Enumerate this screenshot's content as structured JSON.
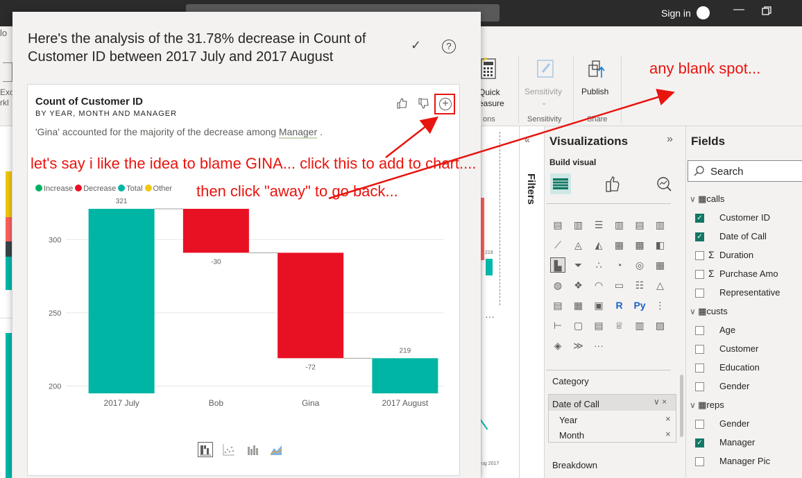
{
  "titlebar": {
    "sign_in": "Sign in",
    "min_icon": "—"
  },
  "ribbon": {
    "quick_measure": "Quick\neasure",
    "sensitivity": "Sensitivity",
    "publish": "Publish",
    "group_sensitivity": "Sensitivity",
    "group_share": "Share",
    "group_calcs": "ons",
    "left_cut_1": "Exc",
    "left_cut_2": "rkl",
    "left_cut_3": "lo"
  },
  "annotations": {
    "any_blank": "any blank spot...",
    "line1": "let's say i like the idea to blame GINA... click this to add to chart....",
    "line2": "then click \"away\" to go back...",
    "color": "#e8140e"
  },
  "modal": {
    "title": "Here's the analysis of the 31.78% decrease in Count of Customer ID between 2017 July and 2017 August",
    "card": {
      "title": "Count of Customer ID",
      "subtitle": "BY YEAR, MONTH AND MANAGER",
      "insight_pre": "'Gina' accounted for the majority of the decrease among ",
      "insight_field": "Manager",
      "insight_post": " ."
    }
  },
  "chart_data": {
    "type": "waterfall",
    "legend": [
      {
        "name": "Increase",
        "color": "#01b163"
      },
      {
        "name": "Decrease",
        "color": "#e81123"
      },
      {
        "name": "Total",
        "color": "#00b5a3"
      },
      {
        "name": "Other",
        "color": "#f2c80f"
      }
    ],
    "categories": [
      "2017 July",
      "Bob",
      "Gina",
      "2017 August"
    ],
    "bars": [
      {
        "category": "2017 July",
        "kind": "Total",
        "start": 0,
        "end": 321,
        "label": "321"
      },
      {
        "category": "Bob",
        "kind": "Decrease",
        "start": 321,
        "end": 291,
        "label": "-30"
      },
      {
        "category": "Gina",
        "kind": "Decrease",
        "start": 291,
        "end": 219,
        "label": "-72"
      },
      {
        "category": "2017 August",
        "kind": "Total",
        "start": 0,
        "end": 219,
        "label": "219"
      }
    ],
    "y_ticks": [
      200,
      250,
      300
    ],
    "ylim": [
      195,
      330
    ],
    "grid": true
  },
  "visualizations": {
    "title": "Visualizations",
    "build_visual": "Build visual",
    "category_label": "Category",
    "category_wells": [
      "Date of Call",
      "Year",
      "Month"
    ],
    "breakdown_label": "Breakdown"
  },
  "filters": {
    "label": "Filters"
  },
  "fields": {
    "title": "Fields",
    "search_placeholder": "Search",
    "tables": [
      {
        "name": "calls",
        "items": [
          {
            "label": "Customer ID",
            "checked": true,
            "sigma": false
          },
          {
            "label": "Date of Call",
            "checked": true,
            "sigma": false
          },
          {
            "label": "Duration",
            "checked": false,
            "sigma": true
          },
          {
            "label": "Purchase Amo",
            "checked": false,
            "sigma": true
          },
          {
            "label": "Representative",
            "checked": false,
            "sigma": false
          }
        ]
      },
      {
        "name": "custs",
        "items": [
          {
            "label": "Age",
            "checked": false
          },
          {
            "label": "Customer",
            "checked": false
          },
          {
            "label": "Education",
            "checked": false
          },
          {
            "label": "Gender",
            "checked": false
          }
        ]
      },
      {
        "name": "reps",
        "items": [
          {
            "label": "Gender",
            "checked": false
          },
          {
            "label": "Manager",
            "checked": true
          },
          {
            "label": "Manager Pic",
            "checked": false
          }
        ]
      }
    ]
  },
  "background": {
    "canvas_date_label": "ug 2017",
    "canvas_value_label": "219"
  }
}
